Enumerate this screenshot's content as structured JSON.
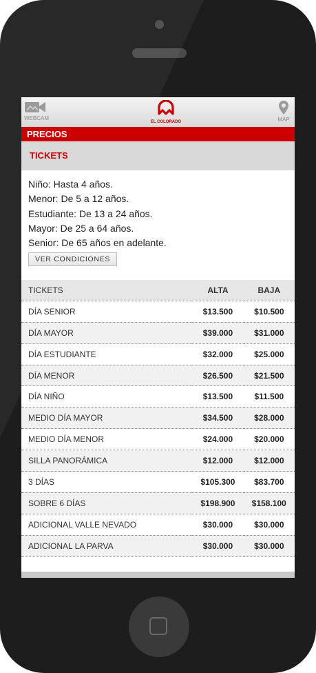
{
  "topbar": {
    "webcam_label": "WEBCAM",
    "map_label": "MAP",
    "logo_text": "EL COLORADO"
  },
  "section_title": "PRECIOS",
  "tickets_header": "TICKETS",
  "age_info": [
    "Niño: Hasta 4 años.",
    "Menor: De 5 a 12 años.",
    "Estudiante: De 13 a 24 años.",
    "Mayor: De 25 a 64 años.",
    "Senior: De 65 años en adelante."
  ],
  "conditions_button": "VER CONDICIONES",
  "table": {
    "headers": [
      "TICKETS",
      "ALTA",
      "BAJA"
    ],
    "rows": [
      [
        "DÍA SENIOR",
        "$13.500",
        "$10.500"
      ],
      [
        "DÍA MAYOR",
        "$39.000",
        "$31.000"
      ],
      [
        "DÍA ESTUDIANTE",
        "$32.000",
        "$25.000"
      ],
      [
        "DÍA MENOR",
        "$26.500",
        "$21.500"
      ],
      [
        "DÍA NIÑO",
        "$13.500",
        "$11.500"
      ],
      [
        "MEDIO DÍA MAYOR",
        "$34.500",
        "$28.000"
      ],
      [
        "MEDIO DÍA MENOR",
        "$24.000",
        "$20.000"
      ],
      [
        "SILLA PANORÁMICA",
        "$12.000",
        "$12.000"
      ],
      [
        "3 DÍAS",
        "$105.300",
        "$83.700"
      ],
      [
        "SOBRE 6 DÍAS",
        "$198.900",
        "$158.100"
      ],
      [
        "ADICIONAL VALLE NEVADO",
        "$30.000",
        "$30.000"
      ],
      [
        "ADICIONAL LA PARVA",
        "$30.000",
        "$30.000"
      ]
    ]
  },
  "colors": {
    "brand_red": "#cc0000",
    "device_body": "#1d1d1d"
  }
}
